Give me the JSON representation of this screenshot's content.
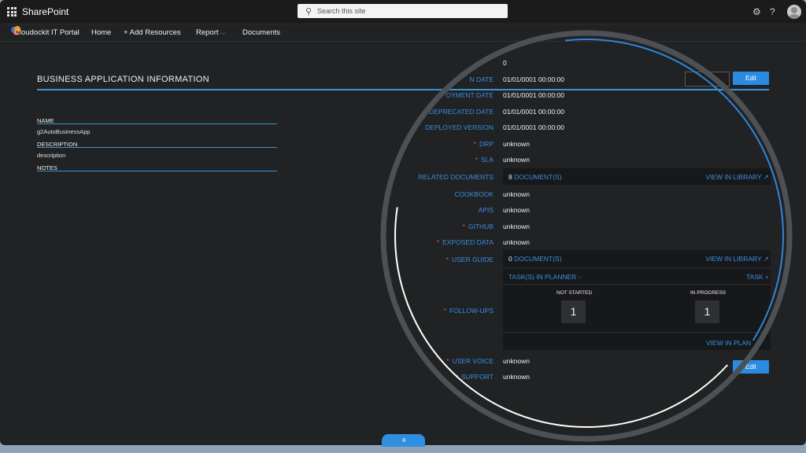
{
  "topbar": {
    "app_name": "SharePoint",
    "search_placeholder": "Search this site",
    "settings_glyph": "⚙",
    "help_glyph": "?"
  },
  "nav": {
    "site_name": "Cloudockit IT Portal",
    "items": [
      {
        "label": "Home"
      },
      {
        "label": "+ Add Resources"
      },
      {
        "label": "Report"
      },
      {
        "label": "Documents"
      }
    ]
  },
  "page": {
    "section_title": "BUSINESS APPLICATION INFORMATION",
    "edit_label": "Edit",
    "left_fields": {
      "name_label": "NAME",
      "name_value": "g2AutoBusinessApp",
      "description_label": "DESCRIPTION",
      "description_value": "description",
      "notes_label": "NOTES"
    },
    "right_fields": {
      "top_value": "0",
      "date1_label": "N DATE",
      "date1_value": "01/01/0001 00:00:00",
      "date2_label": "OYMENT DATE",
      "date2_value": "01/01/0001 00:00:00",
      "deprecated_label": "DEPRECATED DATE",
      "deprecated_value": "01/01/0001 00:00:00",
      "deployed_label": "DEPLOYED VERSION",
      "deployed_value": "01/01/0001 00:00:00",
      "drp_label": "DRP",
      "drp_value": "unknown",
      "sla_label": "SLA",
      "sla_value": "unknown",
      "related_docs_label": "RELATED DOCUMENTS",
      "related_docs_count": "8",
      "related_docs_suffix": "DOCUMENT(S)",
      "view_in_library": "VIEW IN LIBRARY",
      "cookbook_label": "COOKBOOK",
      "cookbook_value": "unknown",
      "apis_label": "APIS",
      "apis_value": "unknown",
      "github_label": "GITHUB",
      "github_value": "unknown",
      "exposed_label": "EXPOSED DATA",
      "exposed_value": "unknown",
      "user_guide_label": "USER GUIDE",
      "user_guide_count": "0",
      "user_guide_suffix": "DOCUMENT(S)",
      "follow_ups_label": "FOLLOW-UPS",
      "tasks_in_planner": "TASK(S) IN PLANNER -",
      "task_add": "TASK +",
      "not_started_label": "NOT STARTED",
      "not_started_value": "1",
      "in_progress_label": "IN PROGRESS",
      "in_progress_value": "1",
      "view_in_planner": "VIEW IN PLAN",
      "user_voice_label": "USER VOICE",
      "user_voice_value": "unknown",
      "support_label": "SUPPORT",
      "support_value": "unknown"
    },
    "scroll_up_glyph": "»"
  },
  "colors": {
    "accent": "#3a8ee0",
    "background": "#202224",
    "required": "#e05050"
  }
}
